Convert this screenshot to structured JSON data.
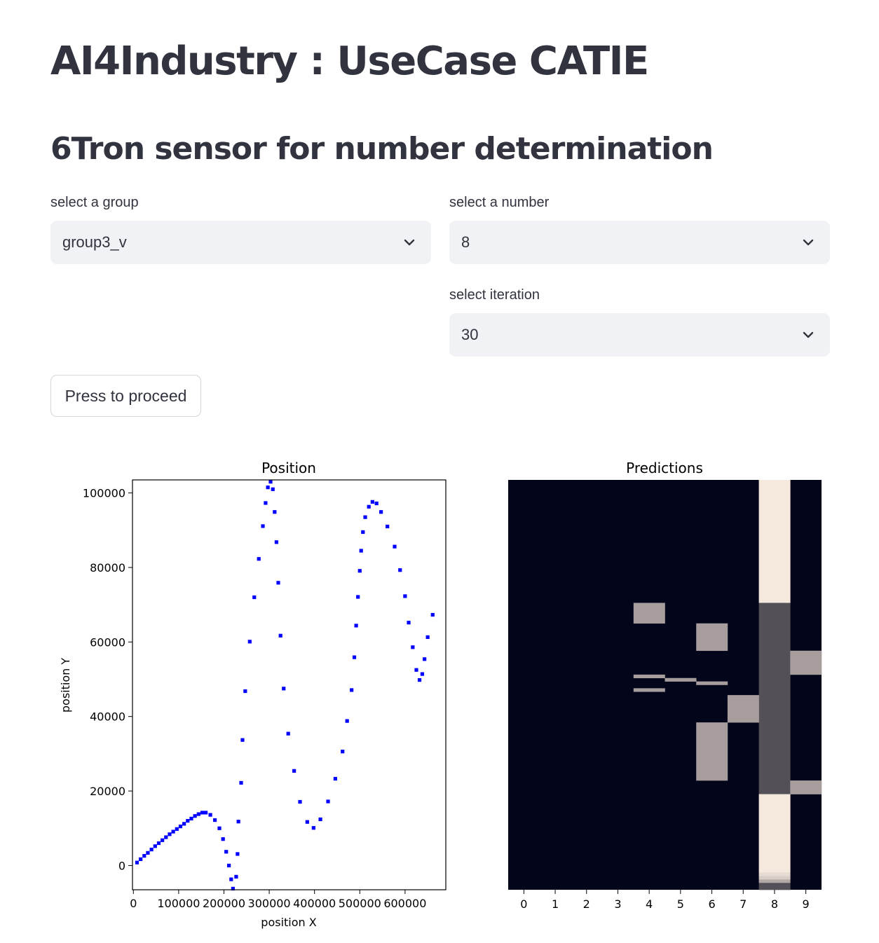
{
  "header": {
    "title": "AI4Industry : UseCase CATIE",
    "subtitle": "6Tron sensor for number determination"
  },
  "controls": {
    "group": {
      "label": "select a group",
      "value": "group3_v"
    },
    "number": {
      "label": "select a number",
      "value": "8"
    },
    "iteration": {
      "label": "select iteration",
      "value": "30"
    },
    "proceed_label": "Press to proceed"
  },
  "icons": {
    "select_chevron": "chevron-down-icon"
  },
  "colors": {
    "point": "#0000ff",
    "heat_dark": "#03051a",
    "heat_light": "#faebdd"
  },
  "chart_data": [
    {
      "type": "scatter",
      "title": "Position",
      "xlabel": "position X",
      "ylabel": "position Y",
      "xlim": [
        -2000,
        690000
      ],
      "ylim": [
        -6500,
        103500
      ],
      "xticks": [
        0,
        100000,
        200000,
        300000,
        400000,
        500000,
        600000
      ],
      "yticks": [
        0,
        20000,
        40000,
        60000,
        80000,
        100000
      ],
      "grid": false,
      "points": [
        [
          8000,
          800
        ],
        [
          16000,
          1700
        ],
        [
          24000,
          2600
        ],
        [
          32000,
          3400
        ],
        [
          40000,
          4300
        ],
        [
          48000,
          5200
        ],
        [
          56000,
          6000
        ],
        [
          64000,
          6800
        ],
        [
          72000,
          7600
        ],
        [
          80000,
          8400
        ],
        [
          88000,
          9100
        ],
        [
          96000,
          9800
        ],
        [
          104000,
          10500
        ],
        [
          112000,
          11200
        ],
        [
          120000,
          12000
        ],
        [
          128000,
          12600
        ],
        [
          136000,
          13300
        ],
        [
          144000,
          13800
        ],
        [
          152000,
          14200
        ],
        [
          160000,
          14200
        ],
        [
          170000,
          13600
        ],
        [
          180000,
          12200
        ],
        [
          190000,
          10000
        ],
        [
          198000,
          7100
        ],
        [
          205000,
          3700
        ],
        [
          211000,
          0
        ],
        [
          216000,
          -3700
        ],
        [
          220000,
          -6200
        ],
        [
          227000,
          -3000
        ],
        [
          230000,
          3100
        ],
        [
          232000,
          11800
        ],
        [
          238000,
          22200
        ],
        [
          241000,
          33700
        ],
        [
          247000,
          46800
        ],
        [
          257000,
          60100
        ],
        [
          267000,
          72000
        ],
        [
          277000,
          82300
        ],
        [
          286000,
          91100
        ],
        [
          292000,
          97300
        ],
        [
          297000,
          101500
        ],
        [
          303000,
          103000
        ],
        [
          308000,
          101000
        ],
        [
          312000,
          94900
        ],
        [
          316000,
          86800
        ],
        [
          320000,
          75900
        ],
        [
          325000,
          61700
        ],
        [
          332000,
          47500
        ],
        [
          342000,
          35400
        ],
        [
          355000,
          25400
        ],
        [
          368000,
          17100
        ],
        [
          384000,
          11700
        ],
        [
          398000,
          10100
        ],
        [
          413000,
          12400
        ],
        [
          430000,
          17200
        ],
        [
          446000,
          23300
        ],
        [
          462000,
          30600
        ],
        [
          472000,
          38800
        ],
        [
          482000,
          47100
        ],
        [
          488000,
          55900
        ],
        [
          492000,
          64400
        ],
        [
          496000,
          72100
        ],
        [
          500000,
          79100
        ],
        [
          503000,
          84500
        ],
        [
          507000,
          89500
        ],
        [
          512000,
          93500
        ],
        [
          520000,
          96300
        ],
        [
          528000,
          97600
        ],
        [
          537000,
          97200
        ],
        [
          547000,
          94900
        ],
        [
          561000,
          91000
        ],
        [
          577000,
          85600
        ],
        [
          589000,
          79300
        ],
        [
          600000,
          72300
        ],
        [
          608000,
          65200
        ],
        [
          617000,
          58600
        ],
        [
          625000,
          52500
        ],
        [
          632000,
          49800
        ],
        [
          638000,
          51400
        ],
        [
          643000,
          55400
        ],
        [
          650000,
          61300
        ],
        [
          661000,
          67300
        ]
      ]
    },
    {
      "type": "heatmap",
      "title": "Predictions",
      "x": [
        0,
        1,
        2,
        3,
        4,
        5,
        6,
        7,
        8,
        9
      ],
      "rows": 120,
      "background": 0,
      "cells": [
        {
          "col": 8,
          "rows": [
            0,
            36
          ],
          "value": 1.0
        },
        {
          "col": 8,
          "rows": [
            36,
            92
          ],
          "value": 0.3
        },
        {
          "col": 8,
          "rows": [
            92,
            115
          ],
          "value": 1.0
        },
        {
          "col": 8,
          "rows": [
            115,
            116
          ],
          "value": 0.9
        },
        {
          "col": 8,
          "rows": [
            116,
            117
          ],
          "value": 0.8
        },
        {
          "col": 8,
          "rows": [
            117,
            118
          ],
          "value": 0.65
        },
        {
          "col": 8,
          "rows": [
            118,
            120
          ],
          "value": 0.3
        },
        {
          "col": 4,
          "rows": [
            36,
            42
          ],
          "value": 0.6
        },
        {
          "col": 6,
          "rows": [
            42,
            50
          ],
          "value": 0.6
        },
        {
          "col": 9,
          "rows": [
            50,
            57
          ],
          "value": 0.6
        },
        {
          "col": 4,
          "rows": [
            57,
            58
          ],
          "value": 0.6
        },
        {
          "col": 5,
          "rows": [
            58,
            59
          ],
          "value": 0.6
        },
        {
          "col": 6,
          "rows": [
            59,
            60
          ],
          "value": 0.6
        },
        {
          "col": 4,
          "rows": [
            61,
            62
          ],
          "value": 0.6
        },
        {
          "col": 7,
          "rows": [
            63,
            71
          ],
          "value": 0.6
        },
        {
          "col": 6,
          "rows": [
            71,
            88
          ],
          "value": 0.6
        },
        {
          "col": 9,
          "rows": [
            88,
            92
          ],
          "value": 0.6
        }
      ]
    }
  ]
}
